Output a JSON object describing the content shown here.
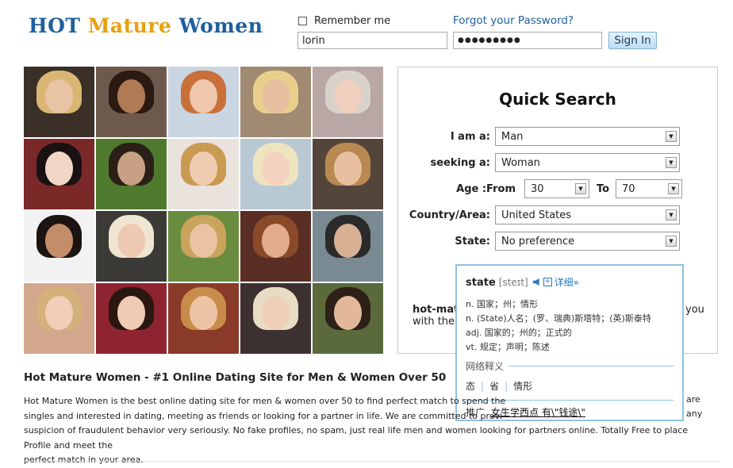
{
  "header": {
    "logo": {
      "hot": "HOT",
      "mature": "Mature",
      "women": "Women"
    },
    "remember_me": "Remember me",
    "forgot_password": "Forgot your Password?",
    "username_value": "lorin",
    "password_value": "●●●●●●●●●",
    "sign_in": "Sign In"
  },
  "quick_search": {
    "title": "Quick Search",
    "i_am_label": "I am a:",
    "i_am_value": "Man",
    "seeking_label": "seeking a:",
    "seeking_value": "Woman",
    "age_label": "Age :From",
    "age_from": "30",
    "to_label": "To",
    "age_to": "70",
    "country_label": "Country/Area:",
    "country_value": "United States",
    "state_label": "State:",
    "state_value": "No preference",
    "partial_left_1": "hot-matu",
    "partial_left_2": "with the",
    "partial_right": "you"
  },
  "dictionary_popup": {
    "word": "state",
    "phonetic": "[steɪt]",
    "more": "详细»",
    "definitions": [
      "n. 国家；州；情形",
      "n. (State)人名；(罗、瑞典)斯塔特；(英)斯泰特",
      "adj. 国家的；州的；正式的",
      "vt. 规定；声明；陈述"
    ],
    "web_heading": "网络释义",
    "web_items": [
      "态",
      "省",
      "情形"
    ],
    "promo_label": "推广",
    "promo_link": "女生学西点 有\\\"钱途\\\""
  },
  "content": {
    "heading": "Hot Mature Women - #1 Online Dating Site for Men & Women Over 50",
    "description_lines": [
      "Hot Mature Women is the best online dating site for men & women over 50 to find perfect match to spend the",
      "singles and interested in dating, meeting as friends or looking for a partner in life. We are committed to provi",
      "suspicion of fraudulent behavior very seriously. No fake profiles, no spam, just real life men and women looking for partners online. Totally Free to place Profile and meet the",
      "perfect match in your area."
    ],
    "desc_right_1": "are",
    "desc_right_2": "any"
  },
  "colors": {
    "brand_blue": "#1e5f9e",
    "brand_gold": "#e8a010",
    "popup_border": "#8ec3e0",
    "link_blue": "#2a78c0"
  }
}
